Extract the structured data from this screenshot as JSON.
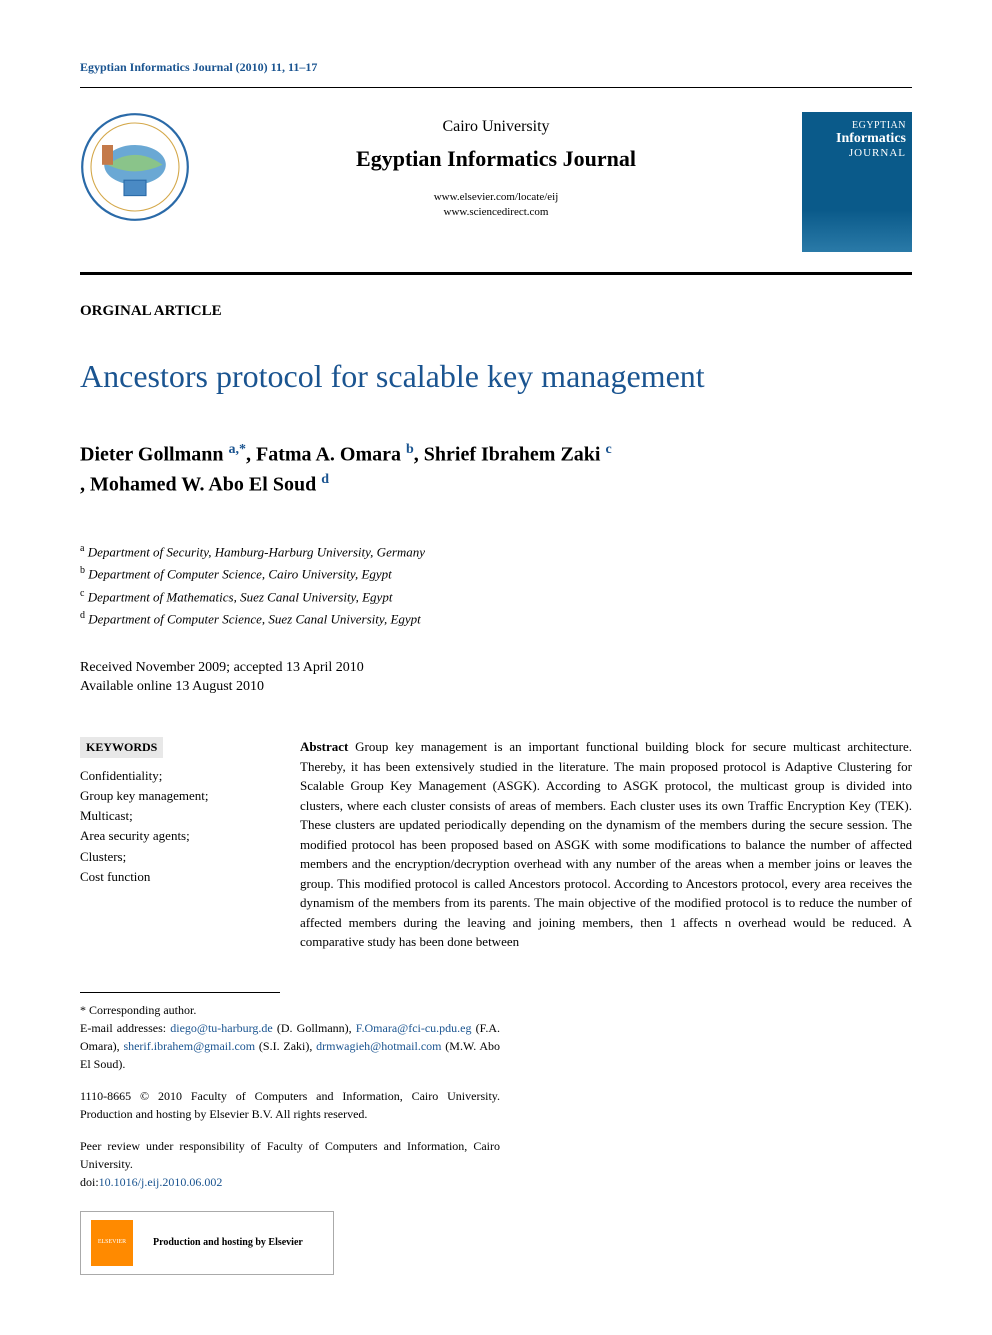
{
  "citation": "Egyptian Informatics Journal (2010) 11, 11–17",
  "header": {
    "publisher": "Cairo University",
    "journal": "Egyptian Informatics Journal",
    "url1": "www.elsevier.com/locate/eij",
    "url2": "www.sciencedirect.com",
    "cover": {
      "line1": "EGYPTIAN",
      "line2": "Informatics",
      "line3": "JOURNAL"
    }
  },
  "article_type": "ORGINAL ARTICLE",
  "title": "Ancestors protocol for scalable key management",
  "authors": [
    {
      "name": "Dieter Gollmann ",
      "marks": "a,*"
    },
    {
      "name": ", Fatma A. Omara ",
      "marks": "b"
    },
    {
      "name": ", Shrief Ibrahem Zaki ",
      "marks": "c"
    },
    {
      "name": ", Mohamed W. Abo El Soud ",
      "marks": "d"
    }
  ],
  "affiliations": [
    {
      "mark": "a",
      "text": " Department of Security, Hamburg-Harburg University, Germany"
    },
    {
      "mark": "b",
      "text": " Department of Computer Science, Cairo University, Egypt"
    },
    {
      "mark": "c",
      "text": " Department of Mathematics, Suez Canal University, Egypt"
    },
    {
      "mark": "d",
      "text": " Department of Computer Science, Suez Canal University, Egypt"
    }
  ],
  "dates": {
    "received": "Received  November 2009; accepted 13 April 2010",
    "online": "Available online 13 August 2010"
  },
  "keywords": {
    "heading": "KEYWORDS",
    "items": "Confidentiality;\nGroup key management;\nMulticast;\nArea security agents;\nClusters;\nCost function"
  },
  "abstract": {
    "label": "Abstract",
    "text": "   Group key management is an important functional building block for secure multicast architecture. Thereby, it has been extensively studied in the literature. The main proposed protocol is Adaptive Clustering for Scalable Group Key Management (ASGK). According to ASGK protocol, the multicast group is divided into clusters, where each cluster consists of areas of members. Each cluster uses its own Traffic Encryption Key (TEK). These clusters are updated periodically depending on the dynamism of the members during the secure session. The modified protocol has been proposed based on ASGK with some modifications to balance the number of affected members and the encryption/decryption overhead with any number of the areas when a member joins or leaves the group. This modified protocol is called Ancestors protocol. According to Ancestors protocol, every area receives the dynamism of the members from its parents. The main objective of the modified protocol is to reduce the number of affected members during the leaving and joining members, then 1 affects n overhead would be reduced. A comparative study has been done between"
  },
  "footnotes": {
    "corresponding": "* Corresponding author.",
    "emails_label": "E-mail addresses: ",
    "emails": [
      {
        "addr": "diego@tu-harburg.de",
        "who": " (D. Gollmann), "
      },
      {
        "addr": "F.Omara@fci-cu.pdu.eg",
        "who": " (F.A. Omara), "
      },
      {
        "addr": "sherif.ibrahem@gmail.com",
        "who": " (S.I. Zaki), "
      },
      {
        "addr": "drmwagieh@hotmail.com",
        "who": " (M.W. Abo El Soud)."
      }
    ],
    "copyright": "1110-8665 © 2010 Faculty of Computers and Information, Cairo University. Production and hosting by Elsevier B.V. All rights reserved.",
    "peer": "Peer review under responsibility of Faculty of Computers and Information, Cairo University.",
    "doi_label": "doi:",
    "doi": "10.1016/j.eij.2010.06.002",
    "hosting": "Production and hosting by Elsevier",
    "elsevier": "ELSEVIER"
  }
}
